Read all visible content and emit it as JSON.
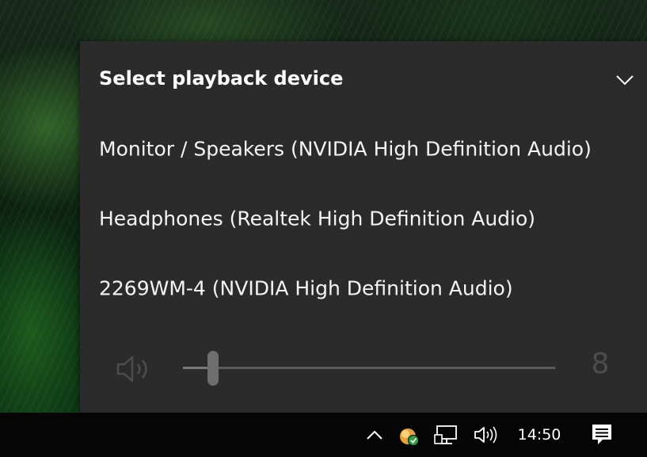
{
  "flyout": {
    "title": "Select playback device",
    "devices": [
      {
        "label": "Monitor / Speakers (NVIDIA High Definition Audio)",
        "selected": false
      },
      {
        "label": "Headphones (Realtek High Definition Audio)",
        "selected": true
      },
      {
        "label": "2269WM-4 (NVIDIA High Definition Audio)",
        "selected": false
      }
    ],
    "volume": {
      "icon": "speaker-icon",
      "value": "8",
      "level": 0.08
    },
    "collapse_icon": "chevron-down-icon"
  },
  "taskbar": {
    "tray_icons": [
      "chevron-up-icon",
      "app-status-icon",
      "network-icon",
      "speaker-icon",
      "notification-icon"
    ],
    "clock": "14:50"
  },
  "colors": {
    "flyout_bg": "#2b2b2b",
    "selected_bg": "#505050",
    "taskbar_bg": "#050505",
    "text": "#ffffff",
    "disabled": "#4d4d4d"
  }
}
